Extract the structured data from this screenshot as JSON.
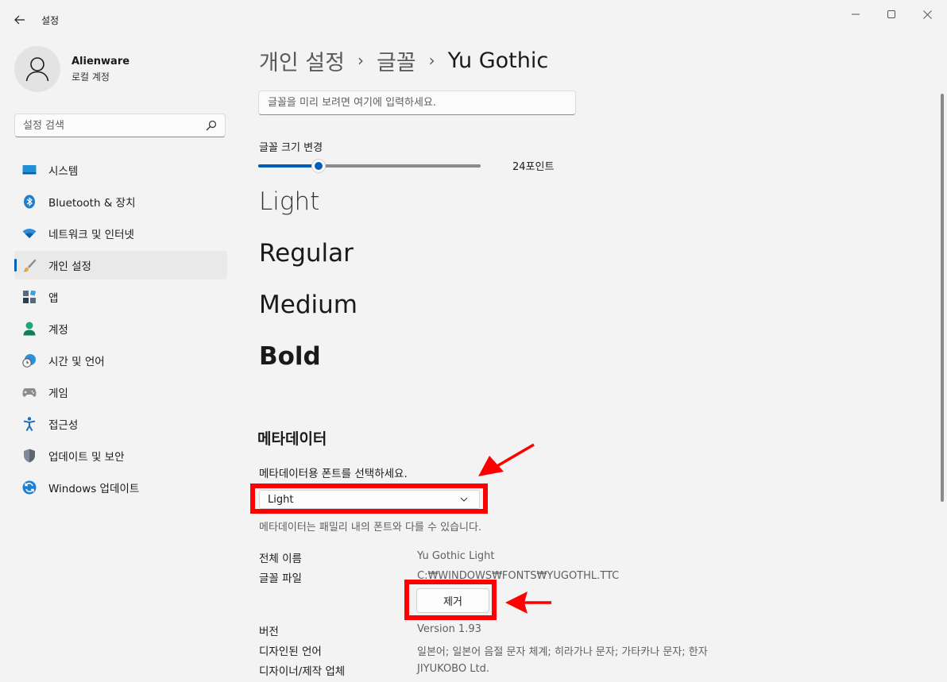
{
  "window": {
    "title": "설정",
    "back_icon": "back-arrow-icon",
    "minimize_icon": "minimize-icon",
    "maximize_icon": "maximize-icon",
    "close_icon": "close-icon"
  },
  "profile": {
    "name": "Alienware",
    "account_type": "로컬 계정"
  },
  "search": {
    "placeholder": "설정 검색",
    "icon": "search-icon"
  },
  "sidebar": {
    "items": [
      {
        "label": "시스템",
        "icon": "system-icon",
        "active": false
      },
      {
        "label": "Bluetooth & 장치",
        "icon": "bluetooth-icon",
        "active": false
      },
      {
        "label": "네트워크 및 인터넷",
        "icon": "wifi-icon",
        "active": false
      },
      {
        "label": "개인 설정",
        "icon": "brush-icon",
        "active": true
      },
      {
        "label": "앱",
        "icon": "apps-icon",
        "active": false
      },
      {
        "label": "계정",
        "icon": "account-icon",
        "active": false
      },
      {
        "label": "시간 및 언어",
        "icon": "clock-globe-icon",
        "active": false
      },
      {
        "label": "게임",
        "icon": "gamepad-icon",
        "active": false
      },
      {
        "label": "접근성",
        "icon": "accessibility-icon",
        "active": false
      },
      {
        "label": "업데이트 및 보안",
        "icon": "shield-icon",
        "active": false
      },
      {
        "label": "Windows 업데이트",
        "icon": "refresh-icon",
        "active": false
      }
    ]
  },
  "breadcrumb": {
    "level1": "개인 설정",
    "level2": "글꼴",
    "current": "Yu Gothic"
  },
  "preview": {
    "placeholder": "글꼴을 미리 보려면 여기에 입력하세요."
  },
  "font_size": {
    "label": "글꼴 크기 변경",
    "value_text": "24포인트",
    "slider_fraction": 0.27
  },
  "samples": {
    "light": "Light",
    "regular": "Regular",
    "medium": "Medium",
    "bold": "Bold"
  },
  "metadata": {
    "heading": "메타데이터",
    "select_label": "메타데이터용 폰트를 선택하세요.",
    "selected": "Light",
    "description": "메타데이터는 패밀리 내의 폰트와 다를 수 있습니다.",
    "full_name_label": "전체 이름",
    "full_name_value": "Yu Gothic Light",
    "file_label": "글꼴 파일",
    "file_value": "C:₩WINDOWS₩FONTS₩YUGOTHL.TTC",
    "remove_button": "제거",
    "version_label": "버전",
    "version_value": "Version 1.93",
    "languages_label": "디자인된 언어",
    "languages_value": "일본어; 일본어 음절 문자 체계; 히라가나 문자; 가타카나 문자; 한자",
    "designer_label": "디자이너/제작 업체",
    "designer_value": "JIYUKOBO Ltd."
  },
  "annotations": {
    "highlight_color": "#ff0000"
  },
  "colors": {
    "accent": "#005fb8",
    "background": "#f3f3f3"
  }
}
